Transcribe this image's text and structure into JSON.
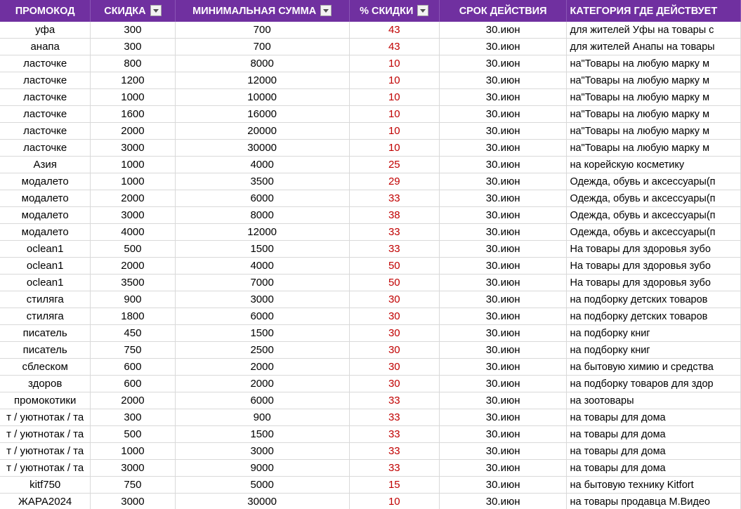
{
  "header": {
    "col1": "ПРОМОКОД",
    "col2": "СКИДКА",
    "col3": "МИНИМАЛЬНАЯ СУММА",
    "col4": "% СКИДКИ",
    "col5": "СРОК ДЕЙСТВИЯ",
    "col6": "КАТЕГОРИЯ ГДЕ ДЕЙСТВУЕТ"
  },
  "rows": [
    [
      "уфа",
      "300",
      "700",
      "43",
      "30.июн",
      "для жителей Уфы  на товары с"
    ],
    [
      "анапа",
      "300",
      "700",
      "43",
      "30.июн",
      "для жителей Анапы  на товары"
    ],
    [
      "ласточке",
      "800",
      "8000",
      "10",
      "30.июн",
      "на\"Товары на любую марку м"
    ],
    [
      "ласточке",
      "1200",
      "12000",
      "10",
      "30.июн",
      "на\"Товары на любую марку м"
    ],
    [
      "ласточке",
      "1000",
      "10000",
      "10",
      "30.июн",
      "на\"Товары на любую марку м"
    ],
    [
      "ласточке",
      "1600",
      "16000",
      "10",
      "30.июн",
      "на\"Товары на любую марку м"
    ],
    [
      "ласточке",
      "2000",
      "20000",
      "10",
      "30.июн",
      "на\"Товары на любую марку м"
    ],
    [
      "ласточке",
      "3000",
      "30000",
      "10",
      "30.июн",
      "на\"Товары на любую марку м"
    ],
    [
      "Азия",
      "1000",
      "4000",
      "25",
      "30.июн",
      "на корейскую косметику"
    ],
    [
      "модалето",
      "1000",
      "3500",
      "29",
      "30.июн",
      "Одежда, обувь и аксессуары(п"
    ],
    [
      "модалето",
      "2000",
      "6000",
      "33",
      "30.июн",
      "Одежда, обувь и аксессуары(п"
    ],
    [
      "модалето",
      "3000",
      "8000",
      "38",
      "30.июн",
      "Одежда, обувь и аксессуары(п"
    ],
    [
      "модалето",
      "4000",
      "12000",
      "33",
      "30.июн",
      "Одежда, обувь и аксессуары(п"
    ],
    [
      "oclean1",
      "500",
      "1500",
      "33",
      "30.июн",
      "На товары для здоровья зубо"
    ],
    [
      "oclean1",
      "2000",
      "4000",
      "50",
      "30.июн",
      "На товары для здоровья зубо"
    ],
    [
      "oclean1",
      "3500",
      "7000",
      "50",
      "30.июн",
      "На товары для здоровья зубо"
    ],
    [
      "стиляга",
      "900",
      "3000",
      "30",
      "30.июн",
      "на подборку детских товаров"
    ],
    [
      "стиляга",
      "1800",
      "6000",
      "30",
      "30.июн",
      "на подборку детских товаров"
    ],
    [
      "писатель",
      "450",
      "1500",
      "30",
      "30.июн",
      "на подборку книг"
    ],
    [
      "писатель",
      "750",
      "2500",
      "30",
      "30.июн",
      "на подборку книг"
    ],
    [
      "сблеском",
      "600",
      "2000",
      "30",
      "30.июн",
      "на бытовую химию и средства"
    ],
    [
      "здоров",
      "600",
      "2000",
      "30",
      "30.июн",
      "на подборку товаров для здор"
    ],
    [
      "промокотики",
      "2000",
      "6000",
      "33",
      "30.июн",
      "на зоотовары"
    ],
    [
      "т / уютнотак / та",
      "300",
      "900",
      "33",
      "30.июн",
      "на товары для дома"
    ],
    [
      "т / уютнотак / та",
      "500",
      "1500",
      "33",
      "30.июн",
      "на товары для дома"
    ],
    [
      "т / уютнотак / та",
      "1000",
      "3000",
      "33",
      "30.июн",
      "на товары для дома"
    ],
    [
      "т / уютнотак / та",
      "3000",
      "9000",
      "33",
      "30.июн",
      "на товары для дома"
    ],
    [
      "kitf750",
      "750",
      "5000",
      "15",
      "30.июн",
      "на бытовую технику Kitfort"
    ],
    [
      "ЖАРА2024",
      "3000",
      "30000",
      "10",
      "30.июн",
      "на товары продавца М.Видео"
    ]
  ]
}
